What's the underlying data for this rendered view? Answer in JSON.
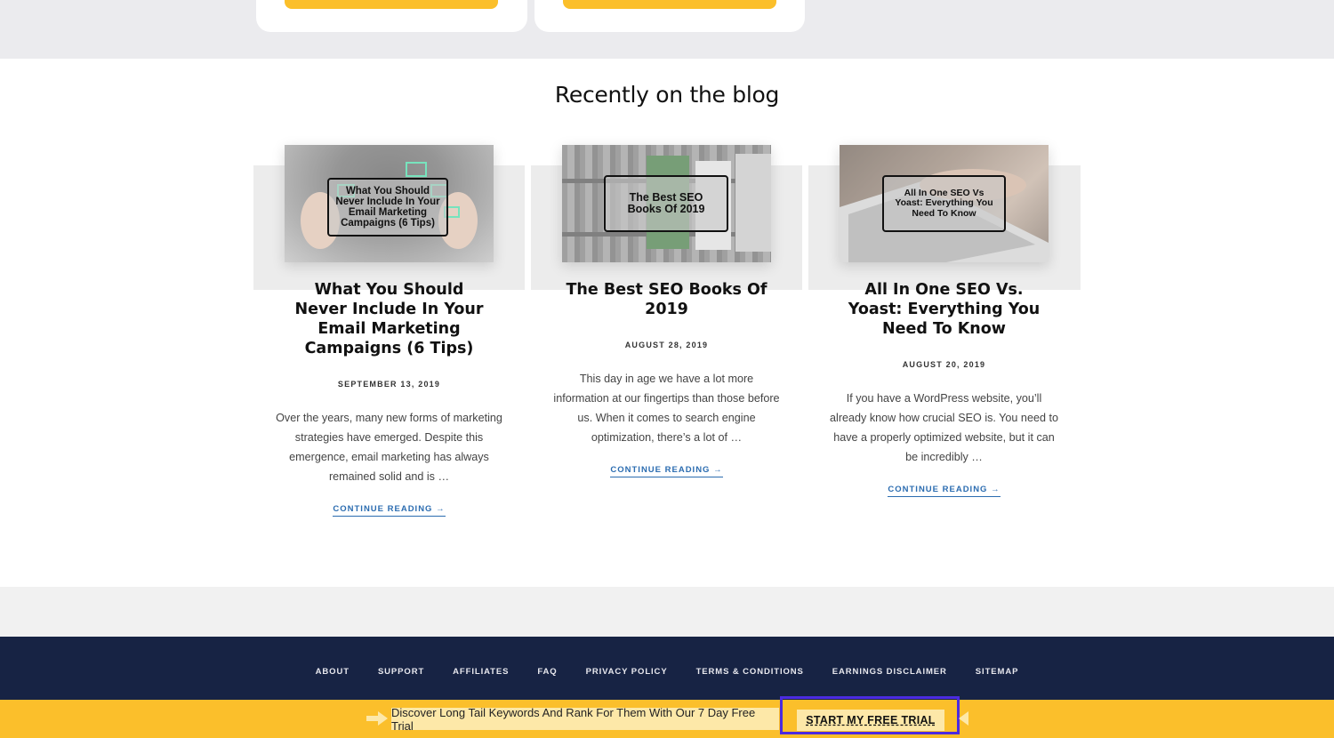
{
  "blog": {
    "heading": "Recently on the blog",
    "posts": [
      {
        "thumb_label": "What You Should Never Include In Your Email Marketing Campaigns (6 Tips)",
        "title": "What You Should Never Include In Your Email Marketing Campaigns (6 Tips)",
        "date": "SEPTEMBER 13, 2019",
        "excerpt": "Over the years, many new forms of marketing strategies have emerged. Despite this emergence, email marketing has always remained solid and is …",
        "more": "CONTINUE READING →"
      },
      {
        "thumb_label": "The Best SEO Books Of 2019",
        "title": "The Best SEO Books Of 2019",
        "date": "AUGUST 28, 2019",
        "excerpt": "This day in age we have a lot more information at our fingertips than those before us. When it comes to search engine optimization, there’s a lot of …",
        "more": "CONTINUE READING →"
      },
      {
        "thumb_label": "All In One SEO Vs Yoast: Everything You Need To Know",
        "title": "All In One SEO Vs. Yoast: Everything You Need To Know",
        "date": "AUGUST 20, 2019",
        "excerpt": "If you have a WordPress website, you’ll already know how crucial SEO is. You need to have a properly optimized website, but it can be incredibly …",
        "more": "CONTINUE READING →"
      }
    ]
  },
  "footer": {
    "nav": [
      "ABOUT",
      "SUPPORT",
      "AFFILIATES",
      "FAQ",
      "PRIVACY POLICY",
      "TERMS & CONDITIONS",
      "EARNINGS DISCLAIMER",
      "SITEMAP"
    ]
  },
  "promo": {
    "text": "Discover Long Tail Keywords And Rank For Them With Our 7 Day Free Trial",
    "button": "START MY FREE TRIAL"
  },
  "colors": {
    "accent_yellow": "#fbbf2b",
    "footer_navy": "#172344",
    "link_blue": "#2b6cb0",
    "highlight_frame": "#4b2be0"
  }
}
